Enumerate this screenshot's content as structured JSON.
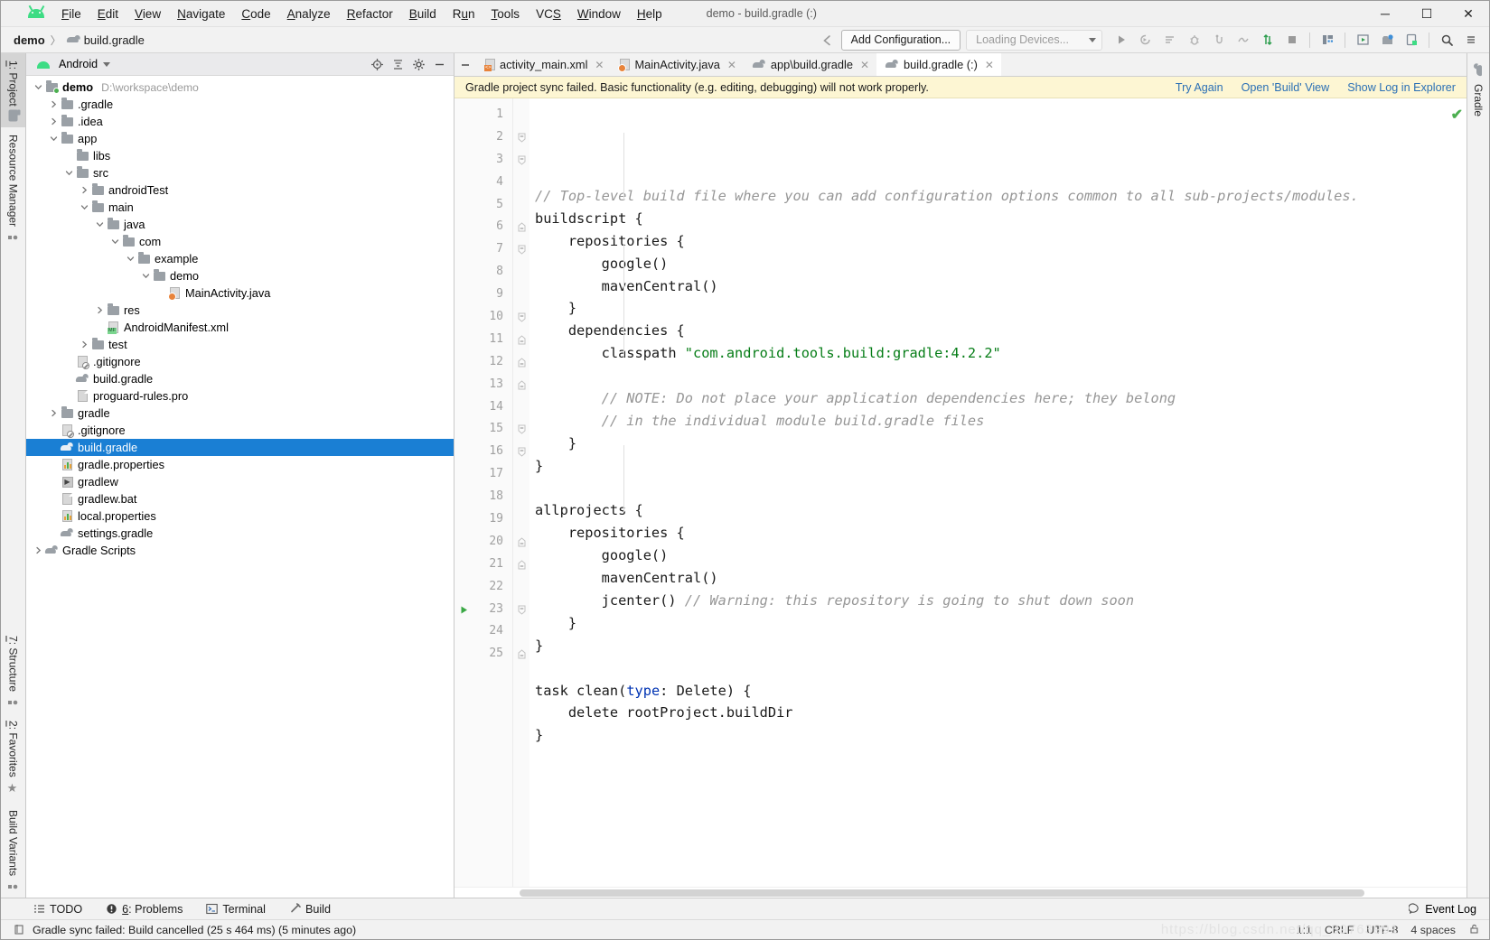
{
  "window": {
    "title": "demo - build.gradle (:)",
    "minimize": "─",
    "maximize": "☐",
    "close": "✕"
  },
  "menu": [
    {
      "label": "File",
      "mnemonic": "F"
    },
    {
      "label": "Edit",
      "mnemonic": "E"
    },
    {
      "label": "View",
      "mnemonic": "V"
    },
    {
      "label": "Navigate",
      "mnemonic": "N"
    },
    {
      "label": "Code",
      "mnemonic": "C"
    },
    {
      "label": "Analyze",
      "mnemonic": "A"
    },
    {
      "label": "Refactor",
      "mnemonic": "R"
    },
    {
      "label": "Build",
      "mnemonic": "B"
    },
    {
      "label": "Run",
      "mnemonic": "u"
    },
    {
      "label": "Tools",
      "mnemonic": "T"
    },
    {
      "label": "VCS",
      "mnemonic": "S"
    },
    {
      "label": "Window",
      "mnemonic": "W"
    },
    {
      "label": "Help",
      "mnemonic": "H"
    }
  ],
  "breadcrumb": {
    "project": "demo",
    "separator": "〉",
    "file": "build.gradle"
  },
  "toolbar": {
    "add_configuration": "Add Configuration...",
    "device_selector": "Loading Devices...",
    "icons": [
      "run-icon",
      "debug-run-icon",
      "run-with-coverage-icon",
      "debug-icon",
      "attach-debugger-icon",
      "profiler-icon",
      "apply-changes-icon",
      "stop-icon",
      "sdk-manager-icon",
      "avd-manager-icon",
      "device-file-explorer-icon",
      "layout-inspector-icon",
      "search-icon",
      "more-icon"
    ]
  },
  "left_rail": {
    "top": [
      {
        "label": "1: Project",
        "mnemonic": "1",
        "icon": "project-folder-icon",
        "active": true
      },
      {
        "label": "Resource Manager",
        "icon": "resource-manager-icon",
        "active": false
      }
    ],
    "bottom": [
      {
        "label": "7: Structure",
        "mnemonic": "7",
        "icon": "structure-icon",
        "active": false
      },
      {
        "label": "2: Favorites",
        "mnemonic": "2",
        "icon": "star-icon",
        "active": false
      },
      {
        "label": "Build Variants",
        "icon": "build-variants-icon",
        "active": false
      }
    ]
  },
  "right_rail": {
    "tabs": [
      {
        "label": "Gradle",
        "icon": "gradle-elephant-icon"
      }
    ]
  },
  "project_panel": {
    "view_name": "Android",
    "tools": [
      "locate-icon",
      "collapse-all-icon",
      "settings-gear-icon",
      "hide-icon"
    ],
    "tree": [
      {
        "indent": 0,
        "arrow": "down",
        "icon": "folder-module",
        "label": "demo",
        "bold": true,
        "path": "D:\\workspace\\demo",
        "selected": false
      },
      {
        "indent": 1,
        "arrow": "right",
        "icon": "folder",
        "label": ".gradle",
        "selected": false
      },
      {
        "indent": 1,
        "arrow": "right",
        "icon": "folder",
        "label": ".idea",
        "selected": false
      },
      {
        "indent": 1,
        "arrow": "down",
        "icon": "folder",
        "label": "app",
        "selected": false
      },
      {
        "indent": 2,
        "arrow": "none",
        "icon": "folder",
        "label": "libs",
        "selected": false
      },
      {
        "indent": 2,
        "arrow": "down",
        "icon": "folder",
        "label": "src",
        "selected": false
      },
      {
        "indent": 3,
        "arrow": "right",
        "icon": "folder",
        "label": "androidTest",
        "selected": false
      },
      {
        "indent": 3,
        "arrow": "down",
        "icon": "folder",
        "label": "main",
        "selected": false
      },
      {
        "indent": 4,
        "arrow": "down",
        "icon": "folder",
        "label": "java",
        "selected": false
      },
      {
        "indent": 5,
        "arrow": "down",
        "icon": "folder",
        "label": "com",
        "selected": false
      },
      {
        "indent": 6,
        "arrow": "down",
        "icon": "folder",
        "label": "example",
        "selected": false
      },
      {
        "indent": 7,
        "arrow": "down",
        "icon": "folder",
        "label": "demo",
        "selected": false
      },
      {
        "indent": 8,
        "arrow": "none",
        "icon": "java",
        "label": "MainActivity.java",
        "selected": false
      },
      {
        "indent": 4,
        "arrow": "right",
        "icon": "folder",
        "label": "res",
        "selected": false
      },
      {
        "indent": 4,
        "arrow": "none",
        "icon": "manifest",
        "label": "AndroidManifest.xml",
        "selected": false
      },
      {
        "indent": 3,
        "arrow": "right",
        "icon": "folder",
        "label": "test",
        "selected": false
      },
      {
        "indent": 2,
        "arrow": "none",
        "icon": "gitignore",
        "label": ".gitignore",
        "selected": false
      },
      {
        "indent": 2,
        "arrow": "none",
        "icon": "gradle",
        "label": "build.gradle",
        "selected": false
      },
      {
        "indent": 2,
        "arrow": "none",
        "icon": "text",
        "label": "proguard-rules.pro",
        "selected": false
      },
      {
        "indent": 1,
        "arrow": "right",
        "icon": "folder",
        "label": "gradle",
        "selected": false
      },
      {
        "indent": 1,
        "arrow": "none",
        "icon": "gitignore",
        "label": ".gitignore",
        "selected": false
      },
      {
        "indent": 1,
        "arrow": "none",
        "icon": "gradle",
        "label": "build.gradle",
        "selected": true
      },
      {
        "indent": 1,
        "arrow": "none",
        "icon": "properties",
        "label": "gradle.properties",
        "selected": false
      },
      {
        "indent": 1,
        "arrow": "none",
        "icon": "shell",
        "label": "gradlew",
        "selected": false
      },
      {
        "indent": 1,
        "arrow": "none",
        "icon": "text",
        "label": "gradlew.bat",
        "selected": false
      },
      {
        "indent": 1,
        "arrow": "none",
        "icon": "properties",
        "label": "local.properties",
        "selected": false
      },
      {
        "indent": 1,
        "arrow": "none",
        "icon": "gradle",
        "label": "settings.gradle",
        "selected": false
      },
      {
        "indent": 0,
        "arrow": "right",
        "icon": "gradle",
        "label": "Gradle Scripts",
        "selected": false
      }
    ]
  },
  "editor_tabs": [
    {
      "label": "activity_main.xml",
      "icon": "layout-xml-icon",
      "active": false,
      "close": "✕"
    },
    {
      "label": "MainActivity.java",
      "icon": "java-icon",
      "active": false,
      "close": "✕"
    },
    {
      "label": "app\\build.gradle",
      "icon": "gradle-icon",
      "active": false,
      "close": "✕"
    },
    {
      "label": "build.gradle (:)",
      "icon": "gradle-icon",
      "active": true,
      "close": "✕"
    }
  ],
  "notification": {
    "message": "Gradle project sync failed. Basic functionality (e.g. editing, debugging) will not work properly.",
    "links": [
      "Try Again",
      "Open 'Build' View",
      "Show Log in Explorer"
    ]
  },
  "code": {
    "language": "groovy",
    "lines": [
      {
        "n": 1,
        "fold": "none",
        "run": false,
        "tokens": [
          {
            "t": "// Top-level build file where you can add configuration options common to all sub-projects/modules.",
            "c": "cm"
          }
        ]
      },
      {
        "n": 2,
        "fold": "start",
        "run": false,
        "tokens": [
          {
            "t": "buildscript {",
            "c": "pln"
          }
        ]
      },
      {
        "n": 3,
        "fold": "start",
        "run": false,
        "tokens": [
          {
            "t": "    repositories {",
            "c": "pln"
          }
        ]
      },
      {
        "n": 4,
        "fold": "none",
        "run": false,
        "tokens": [
          {
            "t": "        google()",
            "c": "pln"
          }
        ]
      },
      {
        "n": 5,
        "fold": "none",
        "run": false,
        "tokens": [
          {
            "t": "        mavenCentral()",
            "c": "pln"
          }
        ]
      },
      {
        "n": 6,
        "fold": "end",
        "run": false,
        "tokens": [
          {
            "t": "    }",
            "c": "pln"
          }
        ]
      },
      {
        "n": 7,
        "fold": "start",
        "run": false,
        "tokens": [
          {
            "t": "    dependencies {",
            "c": "pln"
          }
        ]
      },
      {
        "n": 8,
        "fold": "none",
        "run": false,
        "tokens": [
          {
            "t": "        classpath ",
            "c": "pln"
          },
          {
            "t": "\"com.android.tools.build:gradle:4.2.2\"",
            "c": "str"
          }
        ]
      },
      {
        "n": 9,
        "fold": "none",
        "run": false,
        "tokens": [
          {
            "t": "",
            "c": "pln"
          }
        ]
      },
      {
        "n": 10,
        "fold": "start",
        "run": false,
        "tokens": [
          {
            "t": "        // NOTE: Do not place your application dependencies here; they belong",
            "c": "cm"
          }
        ]
      },
      {
        "n": 11,
        "fold": "end",
        "run": false,
        "tokens": [
          {
            "t": "        // in the individual module build.gradle files",
            "c": "cm"
          }
        ]
      },
      {
        "n": 12,
        "fold": "end",
        "run": false,
        "tokens": [
          {
            "t": "    }",
            "c": "pln"
          }
        ]
      },
      {
        "n": 13,
        "fold": "end",
        "run": false,
        "tokens": [
          {
            "t": "}",
            "c": "pln"
          }
        ]
      },
      {
        "n": 14,
        "fold": "none",
        "run": false,
        "tokens": [
          {
            "t": "",
            "c": "pln"
          }
        ]
      },
      {
        "n": 15,
        "fold": "start",
        "run": false,
        "tokens": [
          {
            "t": "allprojects {",
            "c": "pln"
          }
        ]
      },
      {
        "n": 16,
        "fold": "start",
        "run": false,
        "tokens": [
          {
            "t": "    repositories {",
            "c": "pln"
          }
        ]
      },
      {
        "n": 17,
        "fold": "none",
        "run": false,
        "tokens": [
          {
            "t": "        google()",
            "c": "pln"
          }
        ]
      },
      {
        "n": 18,
        "fold": "none",
        "run": false,
        "tokens": [
          {
            "t": "        mavenCentral()",
            "c": "pln"
          }
        ]
      },
      {
        "n": 19,
        "fold": "none",
        "run": false,
        "tokens": [
          {
            "t": "        jcenter() ",
            "c": "pln"
          },
          {
            "t": "// Warning: this repository is going to shut down soon",
            "c": "cm"
          }
        ]
      },
      {
        "n": 20,
        "fold": "end",
        "run": false,
        "tokens": [
          {
            "t": "    }",
            "c": "pln"
          }
        ]
      },
      {
        "n": 21,
        "fold": "end",
        "run": false,
        "tokens": [
          {
            "t": "}",
            "c": "pln"
          }
        ]
      },
      {
        "n": 22,
        "fold": "none",
        "run": false,
        "tokens": [
          {
            "t": "",
            "c": "pln"
          }
        ]
      },
      {
        "n": 23,
        "fold": "start",
        "run": true,
        "tokens": [
          {
            "t": "task clean(",
            "c": "pln"
          },
          {
            "t": "type",
            "c": "kw"
          },
          {
            "t": ": Delete) {",
            "c": "pln"
          }
        ]
      },
      {
        "n": 24,
        "fold": "none",
        "run": false,
        "tokens": [
          {
            "t": "    delete rootProject.buildDir",
            "c": "pln"
          }
        ]
      },
      {
        "n": 25,
        "fold": "end",
        "run": false,
        "tokens": [
          {
            "t": "}",
            "c": "pln"
          }
        ]
      }
    ],
    "inspection_status": "✔"
  },
  "bottom_tabs": [
    {
      "label": "TODO",
      "icon": "todo-list-icon",
      "mnemonic": ""
    },
    {
      "label": "6: Problems",
      "icon": "problems-warning-icon",
      "mnemonic": "6"
    },
    {
      "label": "Terminal",
      "icon": "terminal-icon",
      "mnemonic": ""
    },
    {
      "label": "Build",
      "icon": "build-hammer-icon",
      "mnemonic": ""
    }
  ],
  "event_log": {
    "label": "Event Log",
    "icon": "event-log-balloon-icon"
  },
  "statusbar": {
    "message": "Gradle sync failed: Build cancelled (25 s 464 ms) (5 minutes ago)",
    "caret_position": "1:1",
    "line_separator": "CRLF",
    "encoding": "UTF-8",
    "indent": "4 spaces",
    "lock_icon": "read-write-lock-icon",
    "watermark": "https://blog.csdn.net/qq_39763991"
  },
  "colors": {
    "selection_blue": "#1a7fd4",
    "notification_yellow": "#fdf6d3",
    "link_blue": "#2a6fb5",
    "comment_gray": "#969696",
    "string_green": "#067d17",
    "keyword_blue": "#0033b3",
    "android_green": "#3ddc84"
  }
}
